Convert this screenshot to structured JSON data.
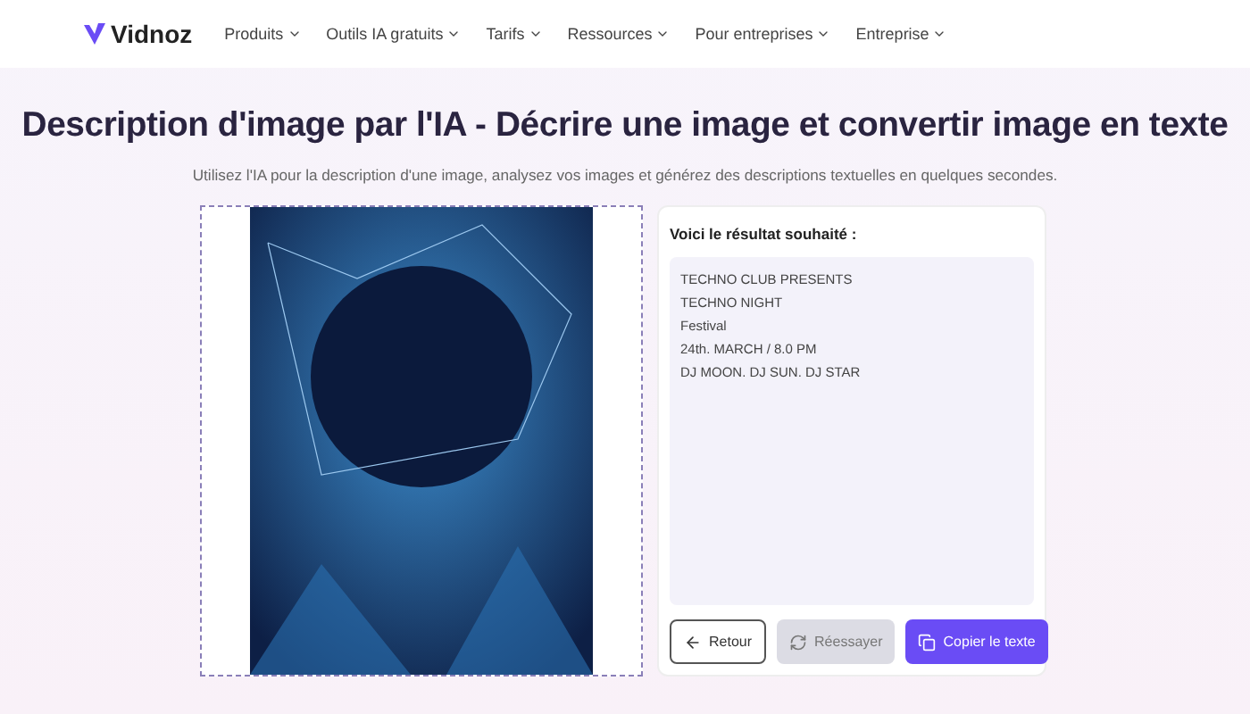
{
  "nav": {
    "logo": "Vidnoz",
    "items": [
      {
        "label": "Produits"
      },
      {
        "label": "Outils IA gratuits"
      },
      {
        "label": "Tarifs"
      },
      {
        "label": "Ressources"
      },
      {
        "label": "Pour entreprises"
      },
      {
        "label": "Entreprise"
      }
    ]
  },
  "title": "Description d'image par l'IA - Décrire une image et convertir image en texte",
  "subtitle": "Utilisez l'IA pour la description d'une image, analysez vos images et générez des descriptions textuelles en quelques secondes.",
  "result": {
    "heading": "Voici le résultat souhaité :",
    "lines": [
      "TECHNO CLUB PRESENTS",
      "TECHNO NIGHT",
      "Festival",
      "24th. MARCH / 8.0 PM",
      "DJ MOON. DJ SUN. DJ STAR"
    ]
  },
  "buttons": [
    {
      "kind": "back",
      "label": "Retour"
    },
    {
      "kind": "retry",
      "label": "Réessayer"
    },
    {
      "kind": "copy",
      "label": "Copier le texte"
    }
  ]
}
